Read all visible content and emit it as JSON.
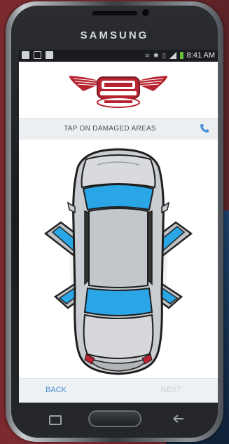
{
  "device": {
    "brand": "SAMSUNG"
  },
  "status_bar": {
    "time": "8:41 AM"
  },
  "app": {
    "logo_text": "",
    "instruction": "TAP ON DAMAGED AREAS",
    "buttons": {
      "back": "BACK",
      "next": "NEXT"
    }
  },
  "colors": {
    "accent": "#4a90d9",
    "logo_red": "#b8242f",
    "glass_blue": "#2aa6e6",
    "disabled": "#c9ced3"
  },
  "icons": {
    "call": "phone-icon",
    "home": "home-button",
    "recent": "recent-apps-icon",
    "hardware_back": "back-arrow-icon"
  }
}
